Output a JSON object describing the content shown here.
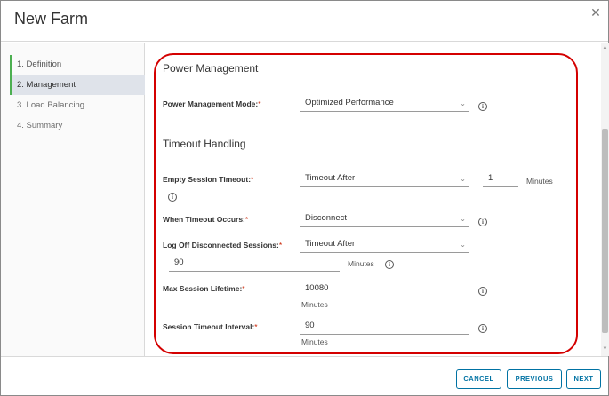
{
  "dialog": {
    "title": "New Farm"
  },
  "steps": [
    {
      "label": "1. Definition"
    },
    {
      "label": "2. Management"
    },
    {
      "label": "3. Load Balancing"
    },
    {
      "label": "4. Summary"
    }
  ],
  "power_management": {
    "section_title": "Power Management",
    "mode_label": "Power Management Mode:",
    "mode_value": "Optimized Performance"
  },
  "timeout_handling": {
    "section_title": "Timeout Handling",
    "empty_session_label": "Empty Session Timeout:",
    "empty_session_value": "Timeout After",
    "empty_session_minutes": "1",
    "when_timeout_label": "When Timeout Occurs:",
    "when_timeout_value": "Disconnect",
    "logoff_label": "Log Off Disconnected Sessions:",
    "logoff_value": "Timeout After",
    "logoff_minutes": "90",
    "max_lifetime_label": "Max Session Lifetime:",
    "max_lifetime_value": "10080",
    "session_interval_label": "Session Timeout Interval:",
    "session_interval_value": "90"
  },
  "units": {
    "minutes": "Minutes"
  },
  "required_marker": "*",
  "footer": {
    "cancel_label": "CANCEL",
    "previous_label": "PREVIOUS",
    "next_label": "NEXT"
  },
  "icons": {
    "close": "close-icon",
    "info": "info-icon",
    "chevron": "chevron-down-icon"
  },
  "colors": {
    "accent": "#0072a3",
    "required": "#c92100",
    "step_indicator": "#4caf50",
    "annotation": "#d40000"
  }
}
